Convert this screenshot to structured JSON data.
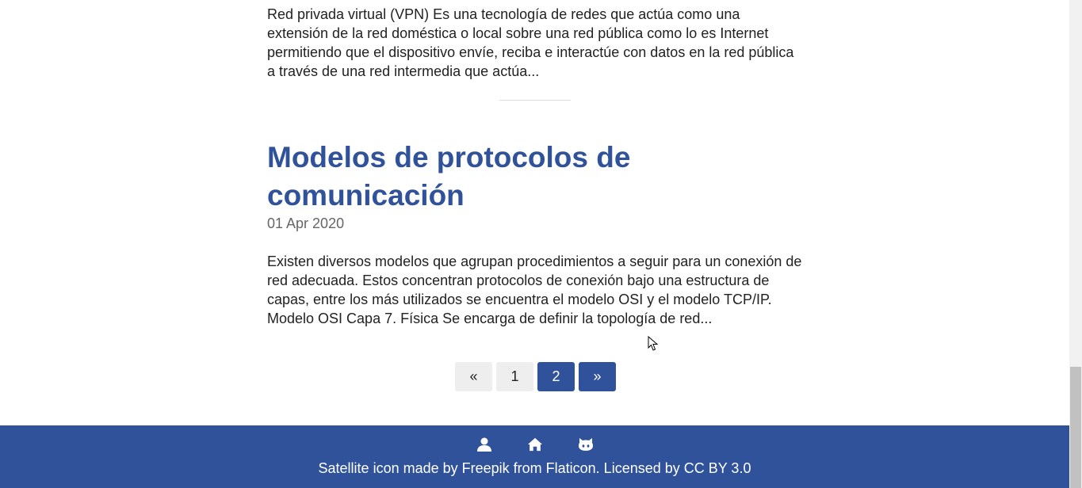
{
  "posts": [
    {
      "excerpt": "Red privada virtual (VPN) Es una tecnología de redes que actúa como una extensión de la red doméstica o local sobre una red pública como lo es Internet permitiendo que el dispositivo envíe, reciba e interactúe con datos en la red pública a través de una red intermedia que actúa..."
    },
    {
      "title": "Modelos de protocolos de comunicación",
      "date": "01 Apr 2020",
      "excerpt": "Existen diversos modelos que agrupan procedimientos a seguir para un conexión de red adecuada. Estos concentran protocolos de conexión bajo una estructura de capas, entre los más utilizados se encuentra el modelo OSI y el modelo TCP/IP. Modelo OSI Capa 7. Física Se encarga de definir la topología de red..."
    }
  ],
  "pagination": {
    "prev": "«",
    "pages": [
      "1",
      "2"
    ],
    "current": "2",
    "next": "»"
  },
  "footer": {
    "icons": [
      "user-icon",
      "home-icon",
      "github-icon"
    ],
    "credit": "Satellite icon made by Freepik from Flaticon. Licensed by CC BY 3.0"
  },
  "colors": {
    "accent": "#30529a",
    "text": "#222222",
    "muted": "#666666",
    "page_button": "#eeeeee"
  }
}
